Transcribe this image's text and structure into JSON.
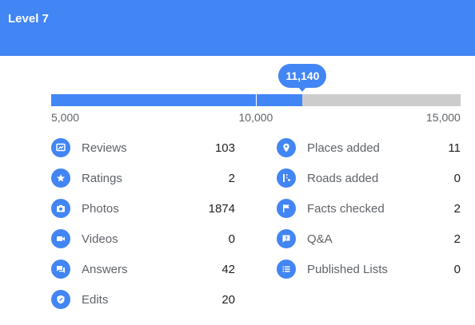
{
  "header": {
    "title": "Level 7",
    "color": "#4285f4"
  },
  "progress": {
    "min": 5000,
    "max": 15000,
    "current": 11140,
    "level_boundary": 10000,
    "current_label": "11,140",
    "ticks": [
      "5,000",
      "10,000",
      "15,000"
    ]
  },
  "stats": {
    "left": [
      {
        "label": "Reviews",
        "value": "103",
        "icon": "reviews-icon"
      },
      {
        "label": "Ratings",
        "value": "2",
        "icon": "star-icon"
      },
      {
        "label": "Photos",
        "value": "1874",
        "icon": "camera-icon"
      },
      {
        "label": "Videos",
        "value": "0",
        "icon": "video-icon"
      },
      {
        "label": "Answers",
        "value": "42",
        "icon": "answers-icon"
      },
      {
        "label": "Edits",
        "value": "20",
        "icon": "edit-icon"
      }
    ],
    "right": [
      {
        "label": "Places added",
        "value": "11",
        "icon": "place-pin-icon"
      },
      {
        "label": "Roads added",
        "value": "0",
        "icon": "road-icon"
      },
      {
        "label": "Facts checked",
        "value": "2",
        "icon": "flag-icon"
      },
      {
        "label": "Q&A",
        "value": "2",
        "icon": "qa-icon"
      },
      {
        "label": "Published Lists",
        "value": "0",
        "icon": "list-icon"
      }
    ]
  }
}
